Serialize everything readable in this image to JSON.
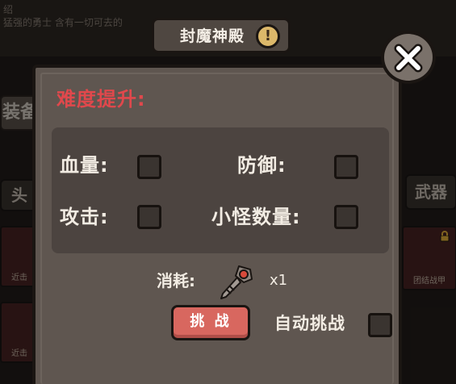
{
  "background": {
    "intro_text": "绍",
    "intro_line": "猛强的勇士 含有一切可去的",
    "tab_label": "装备",
    "left_slot_label": "头",
    "right_slot_label": "武器",
    "card_labels": [
      "近击",
      "近击"
    ],
    "right_card_label": "团结战甲"
  },
  "dialog": {
    "title": "封魔神殿",
    "info_symbol": "!",
    "difficulty_heading": "难度提升:",
    "options": {
      "hp_label": "血量:",
      "defense_label": "防御:",
      "attack_label": "攻击:",
      "minion_count_label": "小怪数量:"
    },
    "cost": {
      "label": "消耗:",
      "quantity": "x1",
      "item_icon": "key-icon"
    },
    "challenge_button": "挑 战",
    "auto_challenge_label": "自动挑战"
  },
  "colors": {
    "heading_red": "#e0484c",
    "button_red": "#d8675f",
    "panel": "#5f5650",
    "inner_panel": "#4c4440"
  }
}
